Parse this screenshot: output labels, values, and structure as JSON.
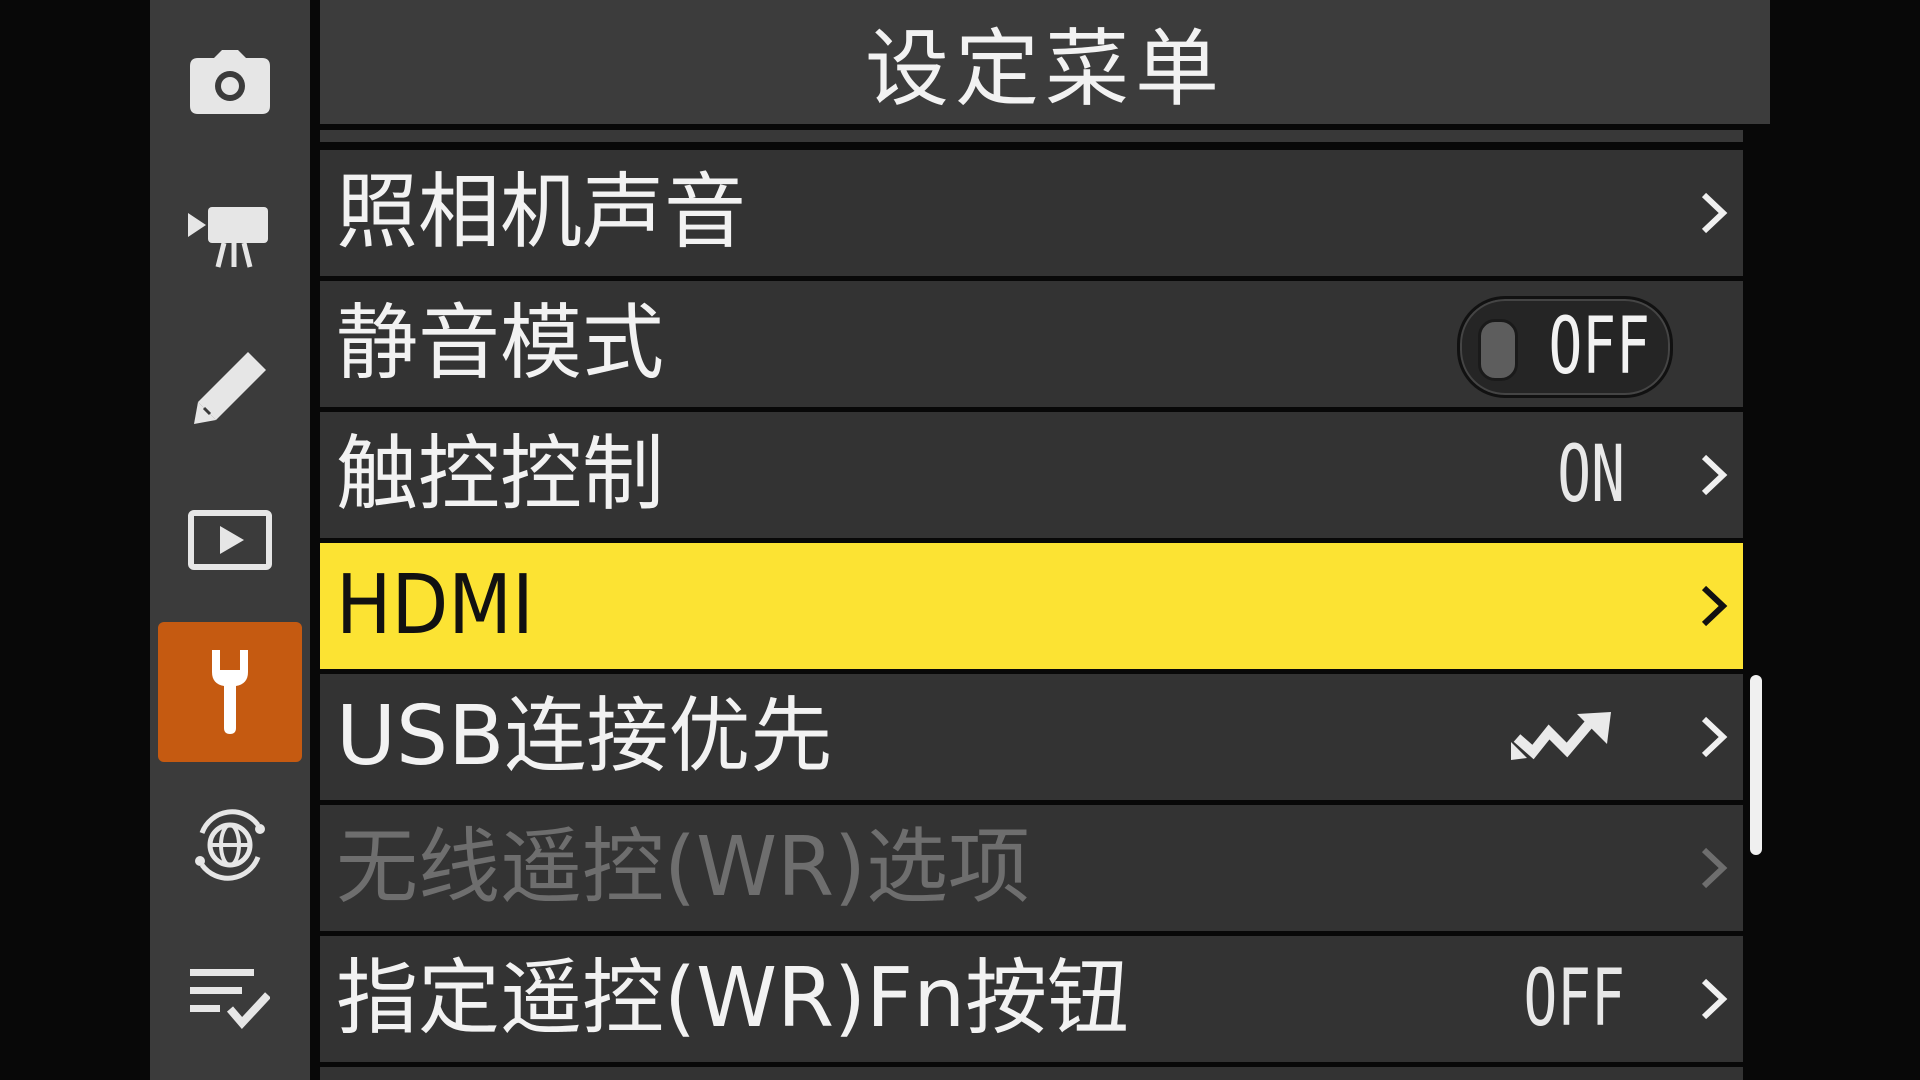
{
  "header": {
    "title": "设定菜单"
  },
  "sidebar": {
    "tabs": [
      {
        "icon": "camera-icon",
        "active": false
      },
      {
        "icon": "movie-camera-icon",
        "active": false
      },
      {
        "icon": "pencil-icon",
        "active": false
      },
      {
        "icon": "playback-icon",
        "active": false
      },
      {
        "icon": "wrench-icon",
        "active": true
      },
      {
        "icon": "network-globe-icon",
        "active": false
      },
      {
        "icon": "my-menu-icon",
        "active": false
      }
    ]
  },
  "menu": {
    "items": [
      {
        "label": "照相机声音",
        "value": "",
        "chevron": true
      },
      {
        "label": "静音模式",
        "toggle": "OFF"
      },
      {
        "label": "触控控制",
        "value": "ON",
        "chevron": true
      },
      {
        "label": "HDMI",
        "value": "",
        "chevron": true,
        "selected": true
      },
      {
        "label": "USB连接优先",
        "value_icon": "usb-connection-icon",
        "chevron": true
      },
      {
        "label": "无线遥控(WR)选项",
        "value": "",
        "chevron": true,
        "disabled": true
      },
      {
        "label": "指定遥控(WR)Fn按钮",
        "value": "OFF",
        "chevron": true
      }
    ]
  },
  "colors": {
    "selected_row": "#fce333",
    "active_tab": "#c55a11",
    "row_bg": "#333333",
    "disabled_text": "#6e6e6e"
  }
}
